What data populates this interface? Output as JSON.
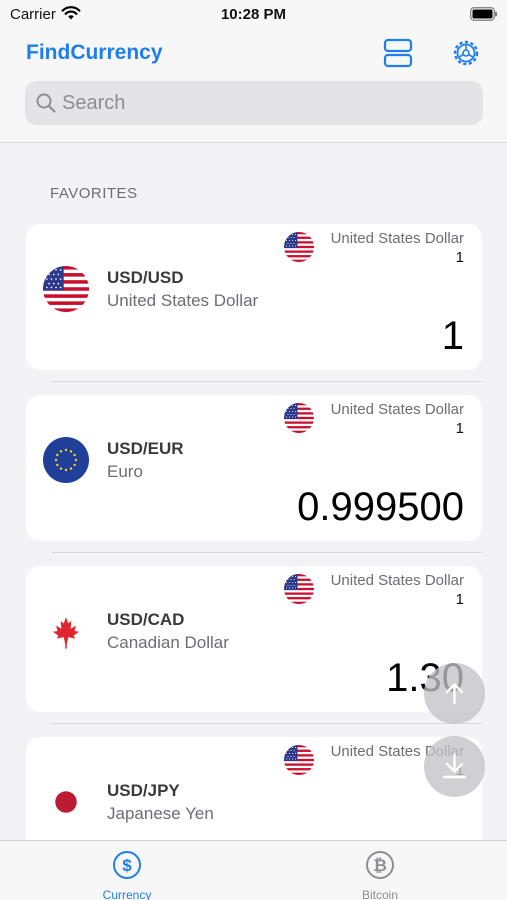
{
  "status_bar": {
    "carrier": "Carrier",
    "time": "10:28 PM"
  },
  "header": {
    "title": "FindCurrency",
    "icons": [
      "layout-icon",
      "gear-icon"
    ]
  },
  "search": {
    "placeholder": "Search"
  },
  "section": {
    "label": "FAVORITES"
  },
  "base": {
    "name": "United States Dollar",
    "amount": "1",
    "flag": "us"
  },
  "currencies": [
    {
      "pair": "USD/USD",
      "name": "United States Dollar",
      "rate": "1",
      "flag": "us"
    },
    {
      "pair": "USD/EUR",
      "name": "Euro",
      "rate": "0.999500",
      "flag": "eu"
    },
    {
      "pair": "USD/CAD",
      "name": "Canadian Dollar",
      "rate": "1.30",
      "flag": "ca"
    },
    {
      "pair": "USD/JPY",
      "name": "Japanese Yen",
      "rate": "",
      "flag": "jp"
    }
  ],
  "fabs": {
    "up": "arrow-up-icon",
    "down": "download-icon"
  },
  "tabs": [
    {
      "label": "Currency",
      "icon": "dollar-icon",
      "active": true
    },
    {
      "label": "Bitcoin",
      "icon": "bitcoin-icon",
      "active": false
    }
  ],
  "colors": {
    "accent": "#1e7fea",
    "background": "#f2f2f7",
    "card": "#ffffff"
  }
}
